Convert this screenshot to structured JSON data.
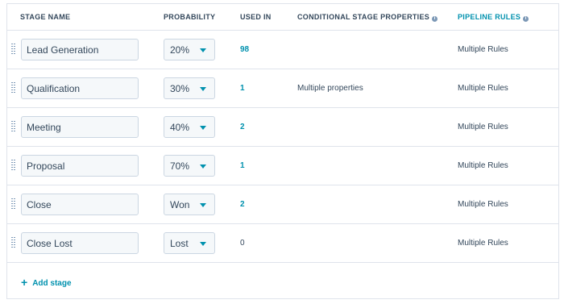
{
  "headers": {
    "stage_name": "STAGE NAME",
    "probability": "PROBABILITY",
    "used_in": "USED IN",
    "conditional": "CONDITIONAL STAGE PROPERTIES",
    "pipeline_rules": "PIPELINE RULES"
  },
  "stages": [
    {
      "name": "Lead Generation",
      "probability": "20%",
      "used_in": "98",
      "conditional": "",
      "rules": "Multiple Rules"
    },
    {
      "name": "Qualification",
      "probability": "30%",
      "used_in": "1",
      "conditional": "Multiple properties",
      "rules": "Multiple Rules"
    },
    {
      "name": "Meeting",
      "probability": "40%",
      "used_in": "2",
      "conditional": "",
      "rules": "Multiple Rules"
    },
    {
      "name": "Proposal",
      "probability": "70%",
      "used_in": "1",
      "conditional": "",
      "rules": "Multiple Rules"
    },
    {
      "name": "Close",
      "probability": "Won",
      "used_in": "2",
      "conditional": "",
      "rules": "Multiple Rules"
    },
    {
      "name": "Close Lost",
      "probability": "Lost",
      "used_in": "0",
      "conditional": "",
      "rules": "Multiple Rules"
    }
  ],
  "add_stage_label": "Add stage",
  "icons": {
    "info": "info-icon",
    "drag": "drag-handle-icon",
    "caret": "caret-down-icon",
    "plus": "plus-icon"
  },
  "colors": {
    "accent": "#0091ae",
    "text": "#33475b",
    "border": "#dfe3eb",
    "input_bg": "#f5f8fa"
  }
}
